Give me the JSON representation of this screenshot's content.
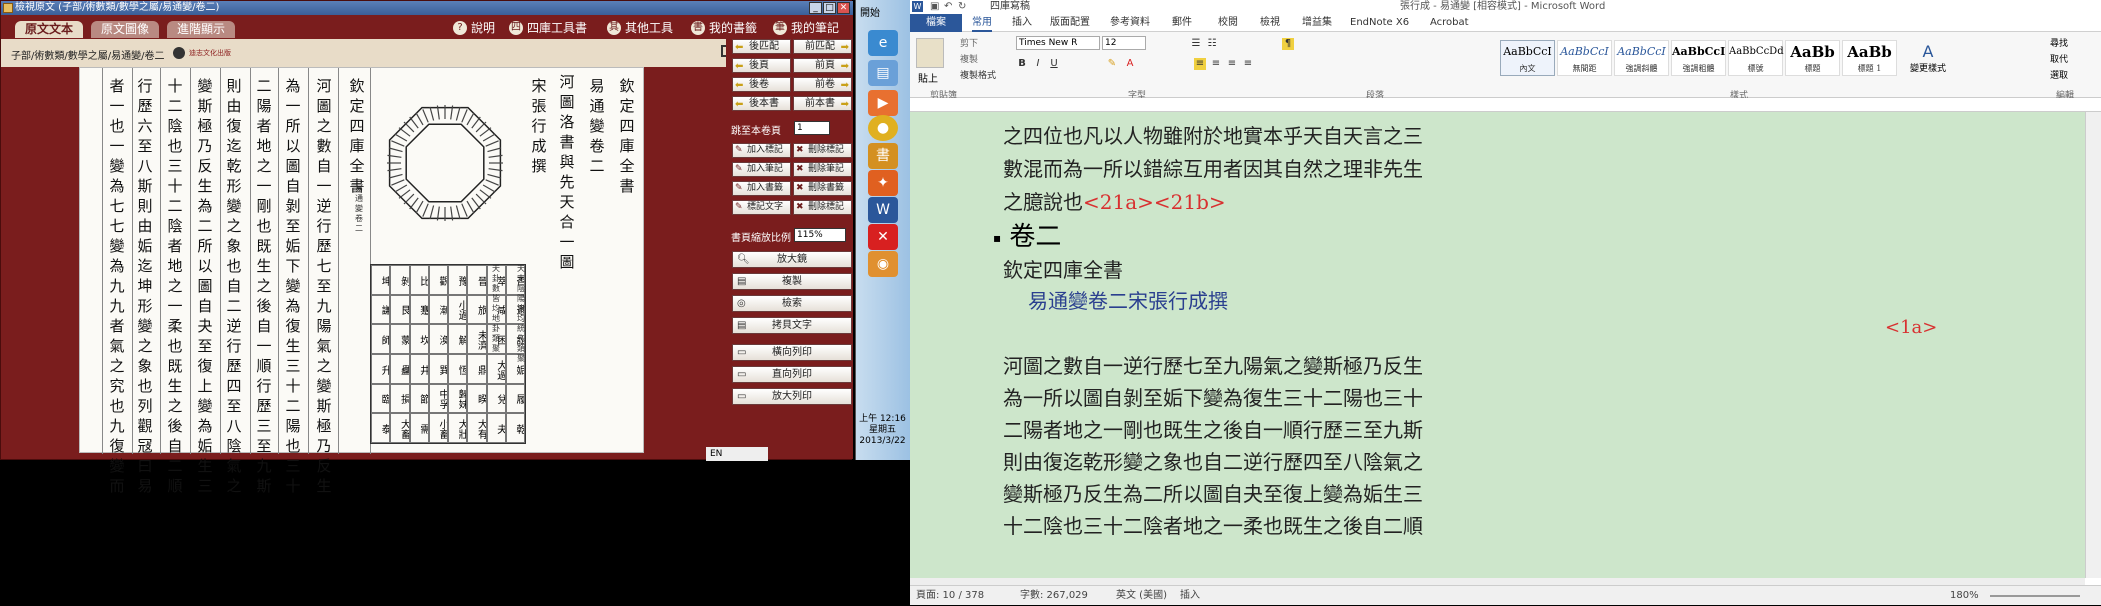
{
  "viewer": {
    "title": "檢視原文 (子部/術數類/數學之屬/易通變/卷二)",
    "tabs": [
      "原文文本",
      "原文圖像",
      "進階顯示"
    ],
    "tools": [
      {
        "icon": "?",
        "label": "說明"
      },
      {
        "icon": "四",
        "label": "四庫工具書"
      },
      {
        "icon": "其",
        "label": "其他工具"
      },
      {
        "icon": "書",
        "label": "我的書籤"
      },
      {
        "icon": "筆",
        "label": "我的筆記"
      }
    ],
    "breadcrumb": "子部/術數類/數學之屬/易通變/卷二",
    "logo_text": "迪志文化出版",
    "columns": [
      "欽定四庫全書",
      "易通變卷二",
      "河圖洛書與先天合一圖",
      "宋 張行成 撰",
      "欽定四庫全書",
      "河圖之數自一逆行歷七至九陽氣之變斯極乃反生",
      "為一所以圖自剝至姤下變為復生三十二陽也三十",
      "二陽者地之一剛也既生之後自一順行歷三至九斯",
      "則由復迄乾形變之象也自二逆行歷四至八陰氣之",
      "變斯極乃反生為二所以圖自夬至復上變為姤生三",
      "十二陰也三十二陰者地之一柔也既生之後自二順",
      "行歷六至八斯則由姤迄坤形變之象也列觀冦曰易",
      "者一也一變為七七變為九九者氣之究也九復變而"
    ],
    "diagram_caption_1": "天支陰陽皆均統先類聚",
    "diagram_caption_2": "天卦數皆均地卦類聚",
    "side_note": "易通變卷二",
    "diagram_cells": [
      "坤",
      "剝",
      "比",
      "觀",
      "豫",
      "晉",
      "萃",
      "否",
      "謙",
      "艮",
      "蹇",
      "漸",
      "小過",
      "旅",
      "咸",
      "遯",
      "師",
      "蒙",
      "坎",
      "渙",
      "解",
      "未濟",
      "困",
      "訟",
      "升",
      "蠱",
      "井",
      "巽",
      "恆",
      "鼎",
      "大過",
      "姤",
      "臨",
      "損",
      "節",
      "中孚",
      "歸妹",
      "睽",
      "兌",
      "履",
      "泰",
      "大畜",
      "需",
      "小畜",
      "大壯",
      "大有",
      "夬",
      "乾"
    ],
    "nav": {
      "prev_match": "前匹配",
      "next_match": "後匹配",
      "prev_page": "前頁",
      "next_page": "後頁",
      "prev_volume": "前卷",
      "next_volume": "後卷",
      "prev_book": "前本書",
      "next_book": "後本書"
    },
    "jump_label": "跳至本卷頁",
    "jump_value": "1",
    "side_buttons": [
      "加入標記",
      "刪除標記",
      "加入筆記",
      "刪除筆記",
      "加入書籤",
      "刪除書籤",
      "標記文字",
      "刪除標記"
    ],
    "zoom_label": "書頁縮放比例",
    "zoom_value": "115%",
    "actions": [
      "放大鏡",
      "複製",
      "檢索",
      "拷貝文字",
      "橫向列印",
      "直向列印",
      "放大列印"
    ],
    "status_lang": "EN"
  },
  "taskbar": {
    "start_label": "開始",
    "clock_time": "上午 12:16",
    "clock_day": "星期五",
    "clock_date": "2013/3/22"
  },
  "word": {
    "title": "張行成 - 易通變 [相容模式] - Microsoft Word",
    "quick_style": "四庫寫稿",
    "tabs": [
      "檔案",
      "常用",
      "插入",
      "版面配置",
      "參考資料",
      "郵件",
      "校閱",
      "檢視",
      "增益集",
      "EndNote X6",
      "Acrobat"
    ],
    "font_name": "Times New R",
    "font_size": "12",
    "groups": [
      "剪貼簿",
      "字型",
      "段落",
      "樣式",
      "編輯"
    ],
    "paste": "貼上",
    "cut": "剪下",
    "copy": "複製",
    "format_painter": "複製格式",
    "styles": [
      {
        "preview": "AaBbCcI",
        "name": "內文"
      },
      {
        "preview": "AaBbCcI",
        "name": "無間距"
      },
      {
        "preview": "AaBbCcI",
        "name": "強調斜體"
      },
      {
        "preview": "AaBbCcI",
        "name": "強調粗體"
      },
      {
        "preview": "AaBbCcDd",
        "name": "標號"
      },
      {
        "preview": "AaBb",
        "name": "標題"
      },
      {
        "preview": "AaBb",
        "name": "標題 1"
      }
    ],
    "change_styles": "變更樣式",
    "find": "尋找",
    "replace": "取代",
    "select": "選取",
    "doc_lines": [
      "之四位也凡以人物雖附於地實本乎天自天言之三",
      "數混而為一所以錯綜互用者因其自然之理非先生",
      "之臆說也"
    ],
    "markers": [
      "<21a>",
      "<21b>",
      "<1a>"
    ],
    "heading": "卷二",
    "line_qinding": "欽定四庫全書",
    "line_author": "易通變卷二宋張行成撰",
    "body_lines": [
      "河圖之數自一逆行歷七至九陽氣之變斯極乃反生",
      "為一所以圖自剝至姤下變為復生三十二陽也三十",
      "二陽者地之一剛也既生之後自一順行歷三至九斯",
      "則由復迄乾形變之象也自二逆行歷四至八陰氣之",
      "變斯極乃反生為二所以圖自夬至復上變為姤生三",
      "十二陰也三十二陰者地之一柔也既生之後自二順"
    ],
    "status": {
      "page": "頁面: 10 / 378",
      "words": "字數: 267,029",
      "lang": "英文 (美國)",
      "mode": "插入",
      "zoom": "180%"
    }
  }
}
